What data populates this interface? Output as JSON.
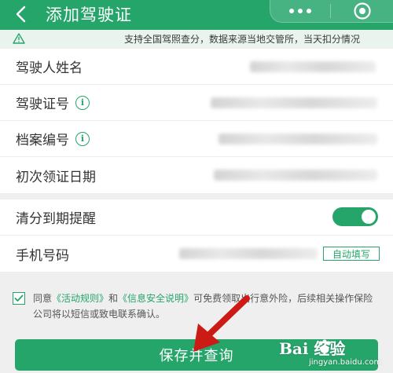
{
  "header": {
    "title": "添加驾驶证",
    "back_icon": "chevron-left-icon",
    "more_icon": "more-dots-icon",
    "close_icon": "target-close-icon"
  },
  "notice": {
    "text": "支持全国驾照查分，数据来源当地交管所，当天扣分情况",
    "icon": "warning-icon"
  },
  "form": {
    "name_label": "驾驶人姓名",
    "license_label": "驾驶证号",
    "file_label": "档案编号",
    "first_date_label": "初次领证日期"
  },
  "reminder": {
    "label": "清分到期提醒",
    "toggle_on": true,
    "phone_label": "手机号码",
    "autofill_label": "自动填写"
  },
  "agreement": {
    "prefix": "同意",
    "link1": "《活动规则》",
    "and": "和",
    "link2": "《信息安全说明》",
    "text": "可免费领取出行意外险，后续相关操作保险公司将以短信或致电联系确认。",
    "checked": true
  },
  "submit": {
    "label": "保存并查询"
  },
  "watermark": {
    "brand": "Bai  经验",
    "url": "jingyan.baidu.com"
  },
  "colors": {
    "primary": "#26a56b",
    "background": "#efefef",
    "arrow": "#cc1a14"
  }
}
